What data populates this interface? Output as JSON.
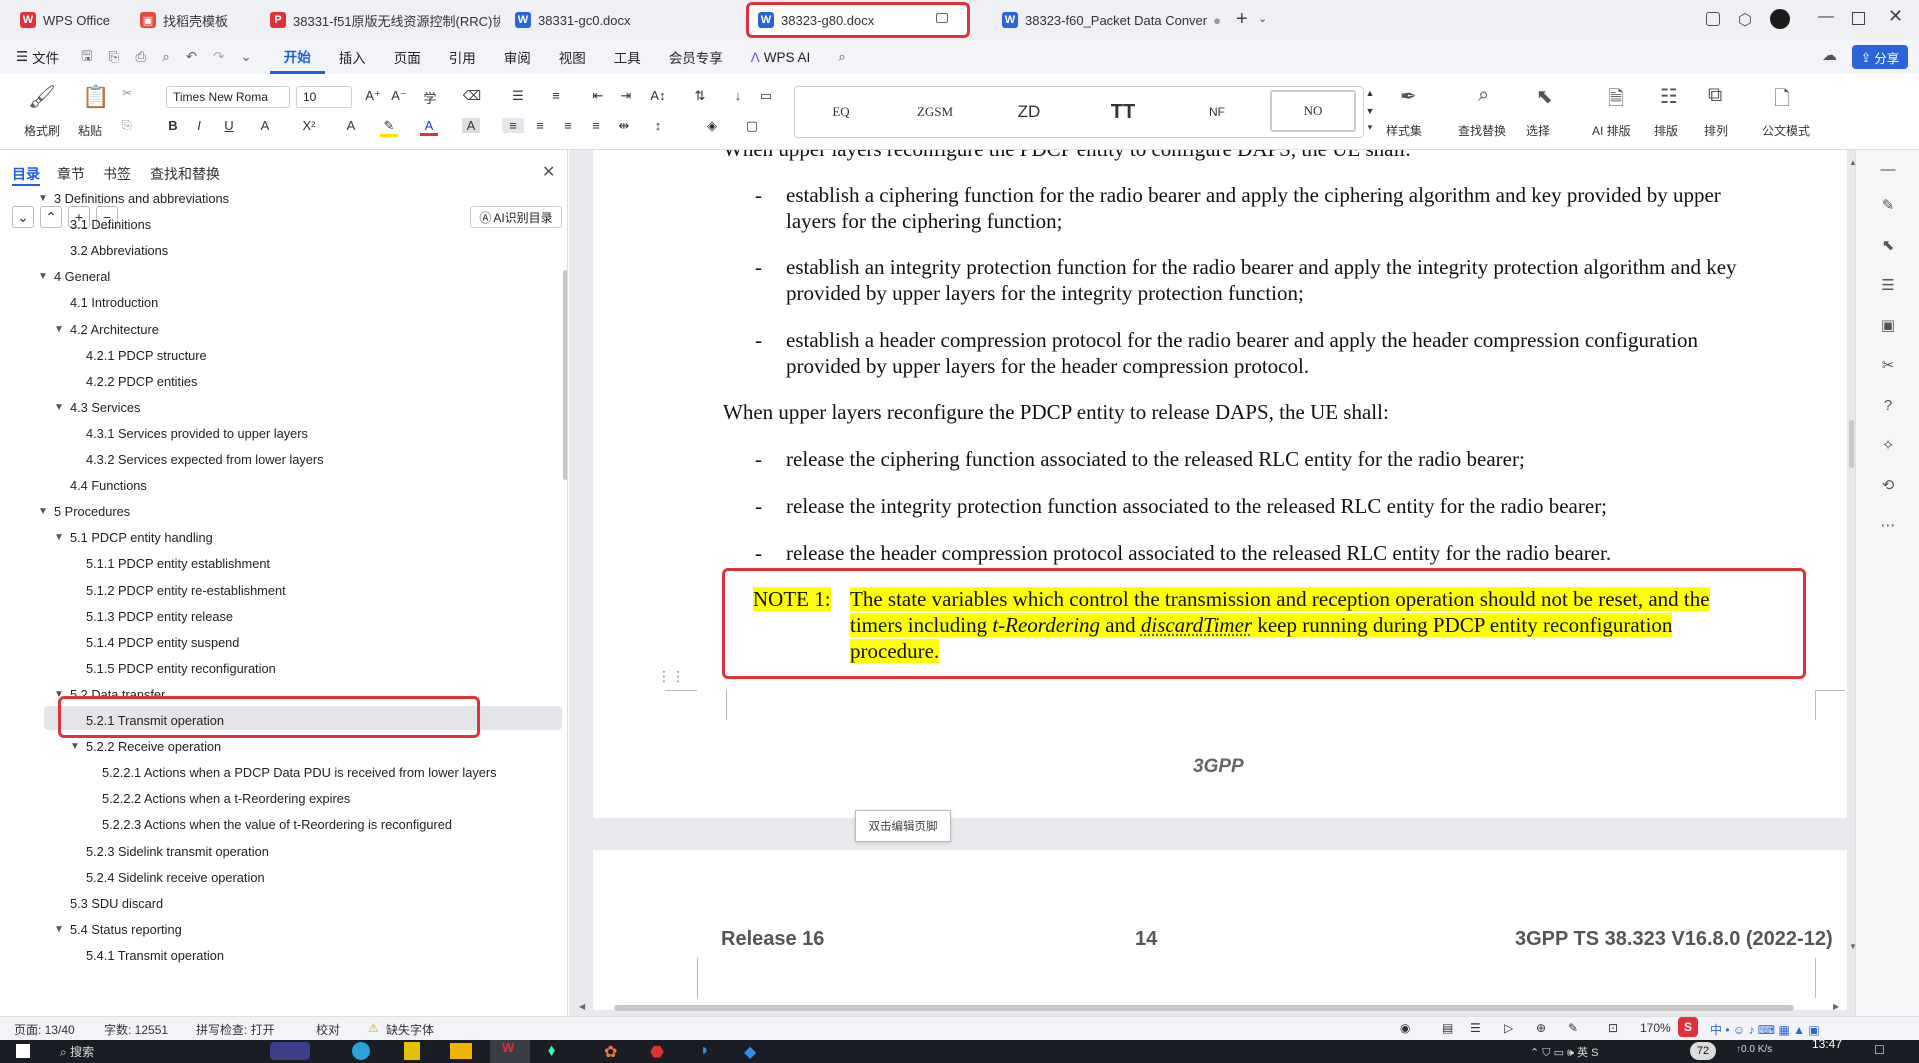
{
  "tabs": [
    {
      "label": "WPS Office",
      "icon": "wps-logo"
    },
    {
      "label": "找稻壳模板",
      "icon": "docer-icon"
    },
    {
      "label": "38331-f51原版无线资源控制(RRC)协",
      "icon": "pdf-icon"
    },
    {
      "label": "38331-gc0.docx",
      "icon": "word-icon"
    },
    {
      "label": "38323-g80.docx",
      "icon": "word-icon"
    },
    {
      "label": "38323-f60_Packet Data Conver",
      "icon": "word-icon"
    }
  ],
  "menu": {
    "file": "文件",
    "items": [
      "开始",
      "插入",
      "页面",
      "引用",
      "审阅",
      "视图",
      "工具",
      "会员专享"
    ],
    "wps_ai": "WPS AI",
    "share": "分享"
  },
  "ribbon": {
    "format_painter": "格式刷",
    "paste": "粘贴",
    "font_name": "Times New Roma",
    "font_size": "10",
    "styles": [
      "EQ",
      "ZGSM",
      "ZD",
      "TT",
      "NF",
      "NO"
    ],
    "style_set": "样式集",
    "find_replace": "查找替换",
    "select": "选择",
    "ai_layout": "AI 排版",
    "layout": "排版",
    "arrange": "排列",
    "official_mode": "公文模式"
  },
  "nav": {
    "tabs": [
      "目录",
      "章节",
      "书签",
      "查找和替换"
    ],
    "ai_toc": "AI识别目录",
    "items": [
      {
        "label": "3 Definitions and abbreviations",
        "level": 0
      },
      {
        "label": "3.1 Definitions",
        "level": 1
      },
      {
        "label": "3.2 Abbreviations",
        "level": 1
      },
      {
        "label": "4 General",
        "level": 0
      },
      {
        "label": "4.1 Introduction",
        "level": 1
      },
      {
        "label": "4.2 Architecture",
        "level": 1
      },
      {
        "label": "4.2.1 PDCP structure",
        "level": 2
      },
      {
        "label": "4.2.2 PDCP entities",
        "level": 2
      },
      {
        "label": "4.3 Services",
        "level": 1
      },
      {
        "label": "4.3.1 Services provided to upper layers",
        "level": 2
      },
      {
        "label": "4.3.2 Services expected from lower layers",
        "level": 2
      },
      {
        "label": "4.4 Functions",
        "level": 1
      },
      {
        "label": "5 Procedures",
        "level": 0
      },
      {
        "label": "5.1 PDCP entity handling",
        "level": 1
      },
      {
        "label": "5.1.1 PDCP entity establishment",
        "level": 2
      },
      {
        "label": "5.1.2 PDCP entity re-establishment",
        "level": 2
      },
      {
        "label": "5.1.3 PDCP entity release",
        "level": 2
      },
      {
        "label": "5.1.4 PDCP entity suspend",
        "level": 2
      },
      {
        "label": "5.1.5 PDCP entity reconfiguration",
        "level": 2
      },
      {
        "label": "5.2 Data transfer",
        "level": 1
      },
      {
        "label": "5.2.1 Transmit operation",
        "level": 2
      },
      {
        "label": "5.2.2 Receive operation",
        "level": 2
      },
      {
        "label": "5.2.2.1 Actions when a PDCP Data PDU is received from lower layers",
        "level": 3
      },
      {
        "label": "5.2.2.2 Actions when a t-Reordering expires",
        "level": 3
      },
      {
        "label": "5.2.2.3 Actions when the value of t-Reordering is reconfigured",
        "level": 3
      },
      {
        "label": "5.2.3 Sidelink transmit operation",
        "level": 2
      },
      {
        "label": "5.2.4 Sidelink receive operation",
        "level": 2
      },
      {
        "label": "5.3 SDU discard",
        "level": 1
      },
      {
        "label": "5.4 Status reporting",
        "level": 1
      },
      {
        "label": "5.4.1 Transmit operation",
        "level": 2
      }
    ]
  },
  "doc": {
    "top_partial": "When upper layers reconfigure the PDCP entity to configure DAPS, the UE shall:",
    "bullets1": [
      [
        "establish a ciphering function for the radio bearer and apply the ciphering algorithm and key provided by upper",
        "layers for the ciphering function;"
      ],
      [
        "establish an integrity protection function for the radio bearer and apply the integrity protection algorithm and key",
        "provided by upper layers for the integrity protection function;"
      ],
      [
        "establish a header compression protocol for the radio bearer and apply the header compression configuration",
        "provided by upper layers for the header compression protocol."
      ]
    ],
    "para2": "When upper layers reconfigure the PDCP entity to release DAPS, the UE shall:",
    "bullets2": [
      "release the ciphering function associated to the released RLC entity for the radio bearer;",
      "release the integrity protection function associated to the released RLC entity for the radio bearer;",
      "release the header compression protocol associated to the released RLC entity for the radio bearer."
    ],
    "bullet_mark": "-",
    "note_label": "NOTE 1:",
    "note_line1": "The state variables which control the transmission and reception operation should not be reset, and the",
    "note_line2_a": "timers including ",
    "note_line2_b": "t-Reordering",
    "note_line2_c": " and ",
    "note_line2_d": "discardTimer",
    "note_line2_e": " keep running during PDCP entity reconfiguration",
    "note_line3": "procedure.",
    "footer_center": "3GPP",
    "edit_footer": "双击编辑页脚",
    "header_left": "Release 16",
    "header_center": "14",
    "header_right": "3GPP TS 38.323 V16.8.0 (2022-12)"
  },
  "status": {
    "page": "页面: 13/40",
    "words": "字数: 12551",
    "spell": "拼写检查: 打开",
    "proof": "校对",
    "missing_font": "缺失字体",
    "zoom": "170%"
  },
  "taskbar": {
    "search": "搜索",
    "time": "13:47",
    "net": "0.0",
    "net_unit": "K/s",
    "battery": "72"
  }
}
